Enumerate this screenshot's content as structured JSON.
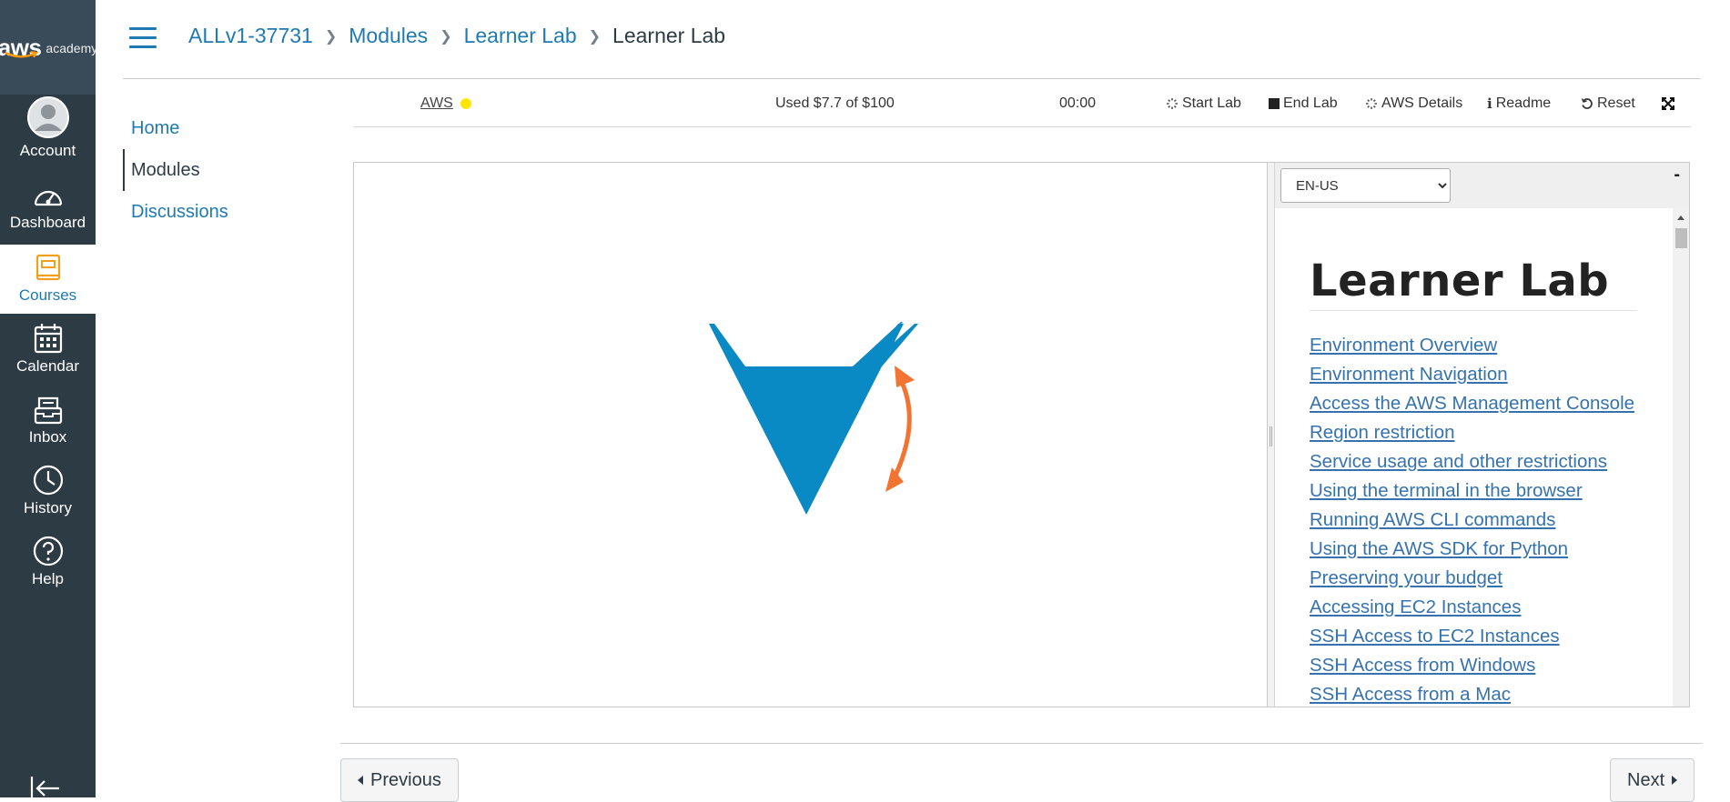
{
  "logo": {
    "aws": "aws",
    "academy": "academy"
  },
  "global_nav": {
    "items": [
      {
        "label": "Account",
        "icon": "account-icon"
      },
      {
        "label": "Dashboard",
        "icon": "dashboard-icon"
      },
      {
        "label": "Courses",
        "icon": "courses-icon"
      },
      {
        "label": "Calendar",
        "icon": "calendar-icon"
      },
      {
        "label": "Inbox",
        "icon": "inbox-icon"
      },
      {
        "label": "History",
        "icon": "history-icon"
      },
      {
        "label": "Help",
        "icon": "help-icon"
      }
    ],
    "active": "Courses"
  },
  "breadcrumb": {
    "course": "ALLv1-37731",
    "modules": "Modules",
    "learner_lab": "Learner Lab",
    "current": "Learner Lab"
  },
  "course_nav": {
    "items": [
      {
        "label": "Home"
      },
      {
        "label": "Modules"
      },
      {
        "label": "Discussions"
      }
    ],
    "active": "Modules"
  },
  "lab_toolbar": {
    "aws_label": "AWS",
    "aws_status_color": "#ffe600",
    "budget": "Used $7.7 of $100",
    "timer": "00:00",
    "start_lab": "Start Lab",
    "end_lab": "End Lab",
    "aws_details": "AWS Details",
    "readme": "Readme",
    "reset": "Reset"
  },
  "readme": {
    "language": "EN-US",
    "minimize": "-",
    "title": "Learner Lab",
    "links": [
      "Environment Overview",
      "Environment Navigation ",
      "Access the AWS Management Console ",
      "Region restriction ",
      "Service usage and other restrictions ",
      "Using the terminal in the browser ",
      "Running AWS CLI commands ",
      "Using the AWS SDK for Python ",
      "Preserving your budget ",
      "Accessing EC2 Instances ",
      "SSH Access to EC2 Instances ",
      "SSH Access from Windows",
      "SSH Access from a Mac"
    ]
  },
  "footer": {
    "previous": "Previous",
    "next": "Next"
  },
  "colors": {
    "nav_bg": "#2d3b45",
    "link": "#1f7ab3",
    "vocareum_blue": "#0a8ac4",
    "vocareum_orange": "#f37432"
  }
}
